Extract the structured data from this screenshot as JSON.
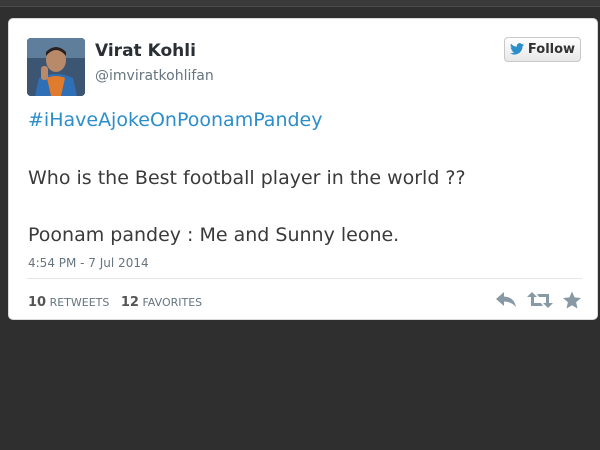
{
  "tweet": {
    "user": {
      "display_name": "Virat Kohli",
      "handle": "@imviratkohlifan",
      "avatar_icon": "profile-photo"
    },
    "follow_button": {
      "label": "Follow",
      "icon": "twitter-bird-icon",
      "icon_color": "#2b8ecb"
    },
    "hashtag": "#iHaveAjokeOnPoonamPandey",
    "lines": [
      "Who is the Best football player in the world ??",
      "Poonam pandey : Me and Sunny leone."
    ],
    "timestamp": "4:54 PM - 7 Jul 2014",
    "stats": {
      "retweets_count": "10",
      "retweets_label": "RETWEETS",
      "favorites_count": "12",
      "favorites_label": "FAVORITES"
    },
    "actions": [
      "reply-icon",
      "retweet-icon",
      "favorite-icon"
    ]
  },
  "colors": {
    "background": "#2f2f2f",
    "card": "#ffffff",
    "link": "#2b8ecb",
    "text": "#3a3a3a",
    "muted": "#66757f",
    "icon_gray": "#8899a6"
  }
}
